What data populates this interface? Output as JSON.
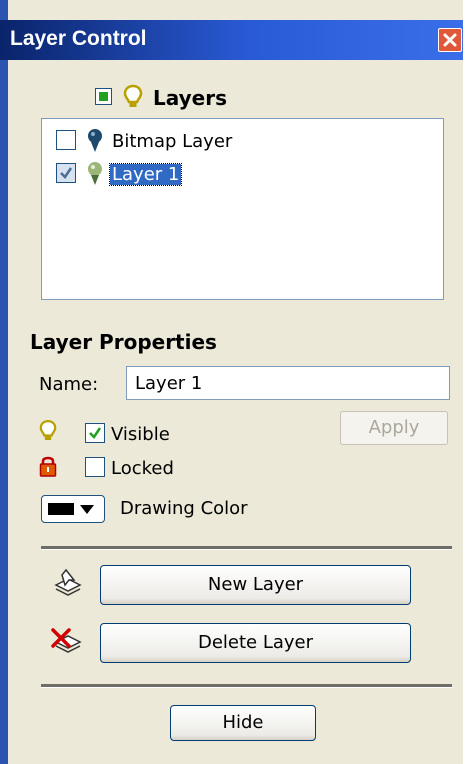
{
  "window": {
    "title": "Layer Control"
  },
  "layers": {
    "header_label": "Layers",
    "items": [
      {
        "label": "Bitmap Layer",
        "checked": false,
        "selected": false
      },
      {
        "label": "Layer 1",
        "checked": true,
        "selected": true
      }
    ]
  },
  "properties": {
    "section_title": "Layer Properties",
    "name_label": "Name:",
    "name_value": "Layer 1",
    "visible_label": "Visible",
    "visible_checked": true,
    "locked_label": "Locked",
    "locked_checked": false,
    "apply_label": "Apply",
    "drawing_color_label": "Drawing Color",
    "drawing_color": "#000000"
  },
  "actions": {
    "new_layer_label": "New Layer",
    "delete_layer_label": "Delete Layer",
    "hide_label": "Hide"
  },
  "icons": [
    "lightbulb-icon",
    "pin-bulb-icon",
    "padlock-icon",
    "new-layer-icon",
    "delete-layer-icon",
    "close-icon"
  ],
  "colors": {
    "title_bar": "#0a246a",
    "panel": "#ece9d8",
    "selection": "#316ac5",
    "close_button": "#e0583a"
  }
}
